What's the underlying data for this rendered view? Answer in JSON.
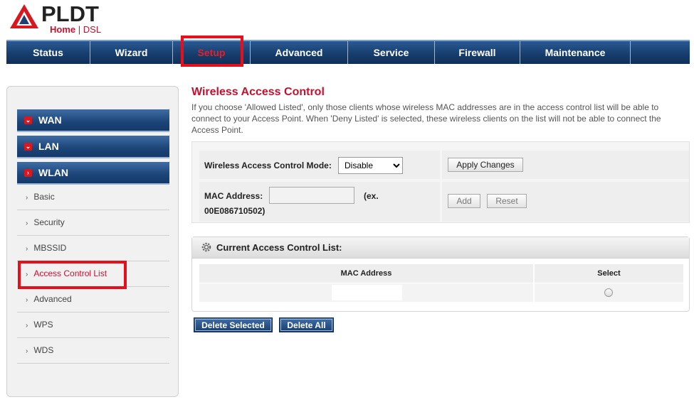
{
  "logo": {
    "brand": "PLDT",
    "sub_home": "Home",
    "sub_sep": "|",
    "sub_dsl": "DSL"
  },
  "nav": {
    "items": [
      {
        "label": "Status"
      },
      {
        "label": "Wizard"
      },
      {
        "label": "Setup",
        "active": true
      },
      {
        "label": "Advanced"
      },
      {
        "label": "Service"
      },
      {
        "label": "Firewall"
      },
      {
        "label": "Maintenance"
      },
      {
        "label": ""
      }
    ]
  },
  "sidebar": {
    "groups": [
      {
        "label": "WAN",
        "marker": "⌄"
      },
      {
        "label": "LAN",
        "marker": "⌄"
      },
      {
        "label": "WLAN",
        "marker": "›"
      }
    ],
    "items": [
      {
        "label": "Basic"
      },
      {
        "label": "Security"
      },
      {
        "label": "MBSSID"
      },
      {
        "label": "Access Control List",
        "active": true
      },
      {
        "label": "Advanced"
      },
      {
        "label": "WPS"
      },
      {
        "label": "WDS"
      }
    ],
    "bullet": "›"
  },
  "main": {
    "title": "Wireless Access Control",
    "description": "If you choose 'Allowed Listed', only those clients whose wireless MAC addresses are in the access control list will be able to connect to your Access Point. When 'Deny Listed' is selected, these wireless clients on the list will not be able to connect the Access Point.",
    "mode_label": "Wireless Access Control Mode:",
    "mode_value": "Disable",
    "apply_label": "Apply Changes",
    "mac_label": "MAC Address:",
    "mac_example": "(ex.",
    "mac_example_value": "00E086710502)",
    "mac_value": "",
    "add_label": "Add",
    "reset_label": "Reset",
    "list_title": "Current Access Control List:",
    "col_mac": "MAC Address",
    "col_select": "Select",
    "delete_selected_label": "Delete Selected",
    "delete_all_label": "Delete All"
  },
  "colors": {
    "accent_red": "#c8102e",
    "nav_blue": "#173e6e",
    "highlight": "#e4101c"
  }
}
